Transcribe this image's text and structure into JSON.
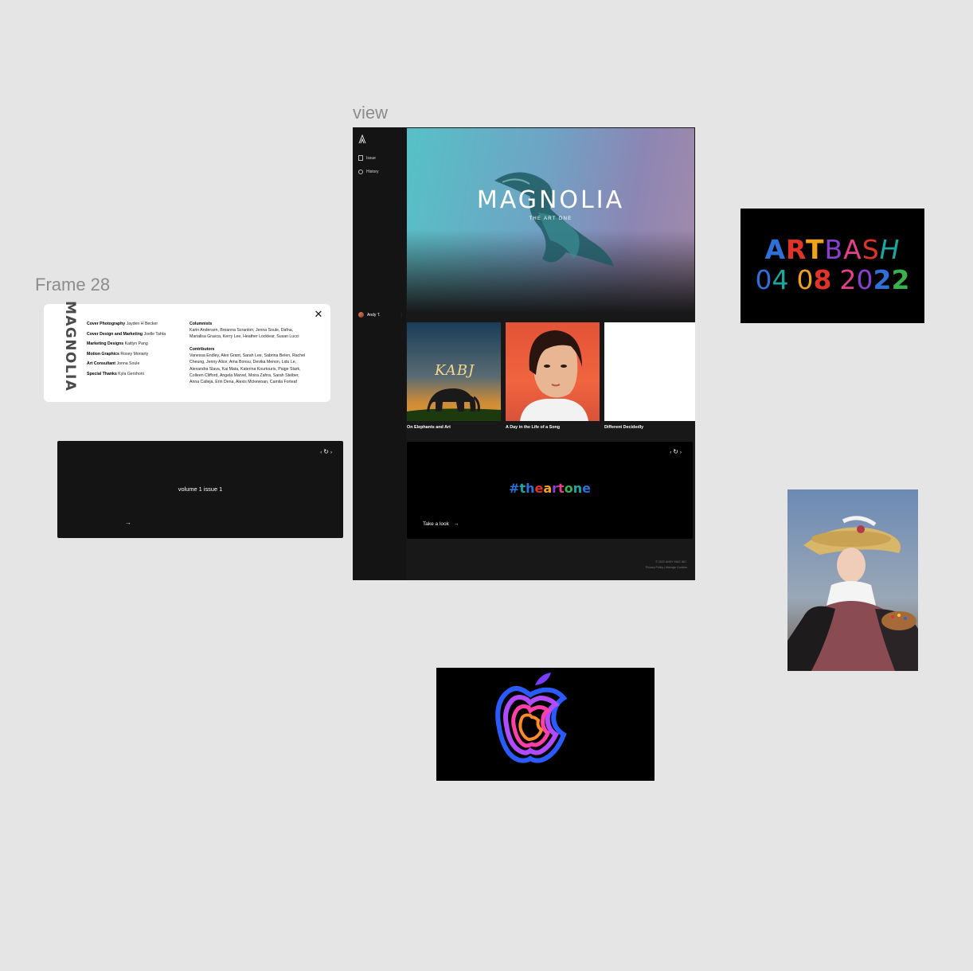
{
  "frames": {
    "frame28_label": "Frame 28",
    "view_label": "view"
  },
  "credits": {
    "logo_text": "MAGNOLIA",
    "close_icon": "close-icon",
    "left": [
      {
        "role": "Cover Photography",
        "name": "Jayden H Becker"
      },
      {
        "role": "Cover Design and Marketing",
        "name": "Joelle Tahta"
      },
      {
        "role": "Marketing Designs",
        "name": "Kaitlyn Pang"
      },
      {
        "role": "Motion Graphics",
        "name": "Rosey Moriarty"
      },
      {
        "role": "Art Consultant",
        "name": "Jonna Soule"
      },
      {
        "role": "Special Thanks",
        "name": "Kyla Gershoni"
      }
    ],
    "columnists_heading": "Columnists",
    "columnists_lines": [
      "Karin Andersen, Breanna Scranton, Jenna Soule, Dafna,",
      "Marialisa Grasca, Kerry Lee, Heather Locklear, Susan Lucci"
    ],
    "contributors_heading": "Contributors",
    "contributors_lines": [
      "Vanessa Endley, Alex Grant, Sarah Lee, Sabrina Belen, Rachel",
      "Cheung, Jenny Alice, Ama Bonsu, Devika Menon, Lidu Le,",
      "Alexandra Slava, Kai Mata, Katerina Kourtouris, Paige Stark,",
      "Colleen Clifford, Angela Marvel, Moira Zahra, Sarah Steiber,",
      "Anna Calleja, Erin Dena, Alexis Mckewoan, Camila Forteaf"
    ]
  },
  "volume": {
    "label": "volume 1 issue 1",
    "arrow": "→"
  },
  "view": {
    "logo": "A",
    "nav": [
      {
        "label": "Issue",
        "icon": "book-icon"
      },
      {
        "label": "History",
        "icon": "history-icon"
      }
    ],
    "user_name": "Andy T.",
    "hero_title": "MAGNOLIA",
    "hero_subtitle": "THE ART ONE",
    "tiles": [
      {
        "caption": "On Elephants and Art",
        "art_text": "KABJ"
      },
      {
        "caption": "A Day in the Life of a Song"
      },
      {
        "caption": "Different Decidedly"
      }
    ],
    "banner": {
      "hashtag_parts": [
        "#",
        "t",
        "h",
        "e",
        "a",
        "r",
        "t",
        "o",
        "n",
        "e"
      ],
      "cta": "Take a look",
      "cta_arrow": "→"
    },
    "footer_line1": "© 2022 ANDY MAG INC.",
    "footer_line2": "Privacy Policy | Manage Cookies"
  },
  "artbash": {
    "word_parts": [
      "A",
      "R",
      "T",
      "B",
      "A",
      "S",
      "H"
    ],
    "date_parts": [
      "0",
      "4",
      "0",
      "8",
      "2",
      "0",
      "2",
      "2"
    ]
  },
  "colors": {
    "canvas": "#e5e5e5",
    "panel_dark": "#181818",
    "rainbow": [
      "#2e6fd8",
      "#e0342a",
      "#f0a21c",
      "#8b3fcf",
      "#e43f8a",
      "#19a8a0",
      "#37b24d",
      "#c940d0"
    ]
  }
}
